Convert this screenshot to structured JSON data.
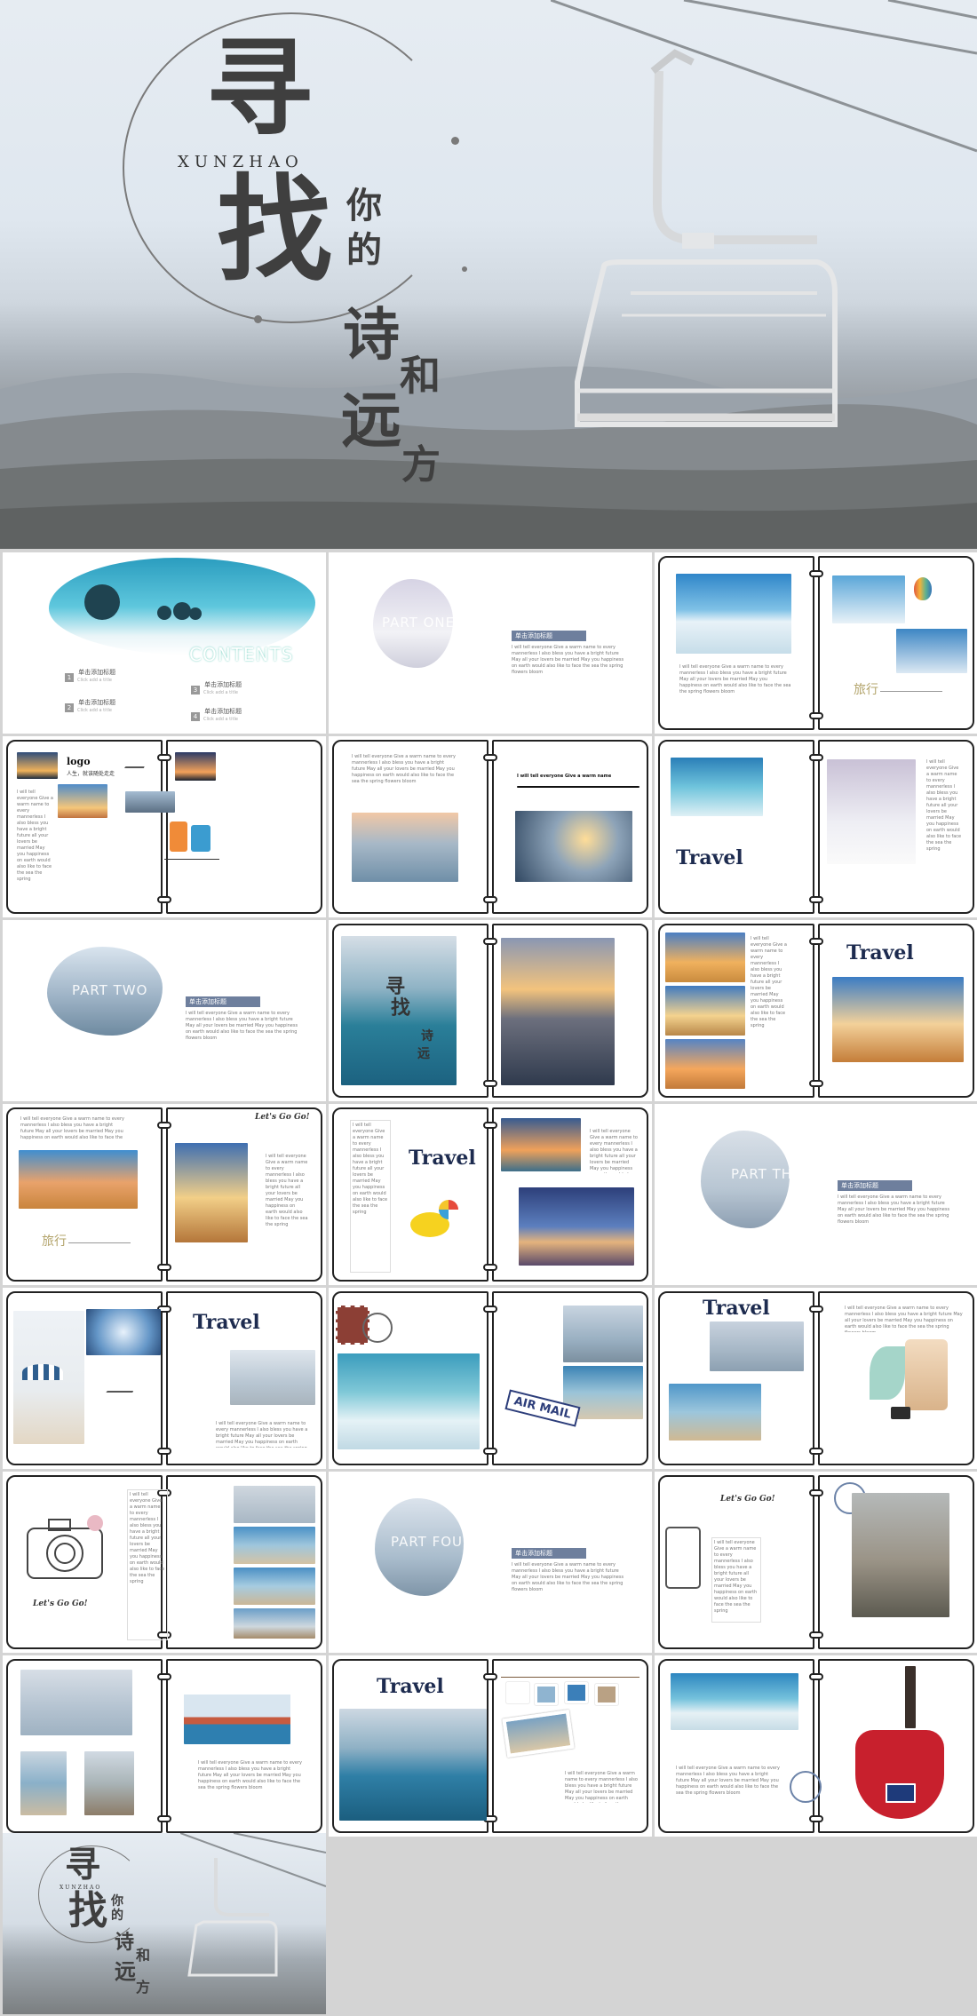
{
  "cover": {
    "big1": "寻",
    "big2": "找",
    "small1": "你",
    "small2": "的",
    "pinyin": "XUNZHAO",
    "line2a": "诗",
    "line2b": "和",
    "line2c": "远",
    "line2d": "方"
  },
  "contents": {
    "title": "CONTENTS",
    "items": [
      {
        "num": "1",
        "title": "单击添加标题",
        "sub": "Click add a title"
      },
      {
        "num": "2",
        "title": "单击添加标题",
        "sub": "Click add a title"
      },
      {
        "num": "3",
        "title": "单击添加标题",
        "sub": "Click add a title"
      },
      {
        "num": "4",
        "title": "单击添加标题",
        "sub": "Click add a title"
      }
    ]
  },
  "parts": {
    "one": "PART ONE",
    "two": "PART TWO",
    "three": "PART THREE",
    "four": "PART FOUR",
    "heading": "单击添加标题",
    "body": "I will tell everyone Give a warm name to every mannerless I also bless you have a bright future May all your lovers be married May you happiness on earth would also like to face the sea the spring flowers bloom"
  },
  "slides": {
    "travel": "Travel",
    "lgg": "Let's Go Go!",
    "logo": "logo",
    "logo_sub": "人生，就该随处走走",
    "air_mail": "AIR MAIL",
    "sig": "旅行",
    "mini_title": "I will tell everyone Give a warm name",
    "para_short": "I will tell everyone Give a warm name to every mannerless I also bless you have a bright future May all your lovers be married May you happiness on earth would also like to face the sea the spring flowers bloom",
    "para_col": "I will tell everyone Give a warm name to every mannerless I also bless you have a bright future all your lovers be married May you happiness on earth would also like to face the sea the spring"
  },
  "ending": {
    "big1": "寻",
    "big2": "找",
    "small1": "你",
    "small2": "的",
    "pinyin": "XUNZHAO",
    "line2a": "诗",
    "line2b": "和",
    "line2c": "远",
    "line2d": "方"
  },
  "colors": {
    "accent": "#6e7f9d",
    "navy": "#1d2b4f",
    "sea": "#2c8fb0",
    "sand": "#c99a4d",
    "snow": "#e8f1f6"
  }
}
